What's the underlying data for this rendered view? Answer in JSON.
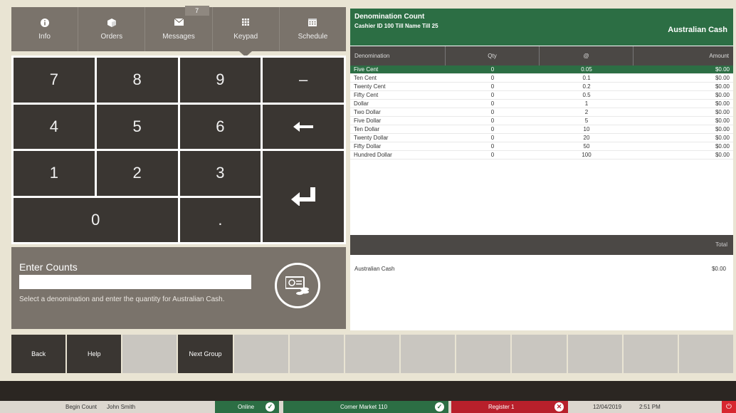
{
  "nav": {
    "items": [
      {
        "label": "Info",
        "icon": "info-icon"
      },
      {
        "label": "Orders",
        "icon": "box-icon"
      },
      {
        "label": "Messages",
        "icon": "envelope-icon",
        "badge": "7"
      },
      {
        "label": "Keypad",
        "icon": "keypad-icon"
      },
      {
        "label": "Schedule",
        "icon": "calendar-icon"
      }
    ]
  },
  "keypad": {
    "keys": [
      "7",
      "8",
      "9",
      "–",
      "4",
      "5",
      "6",
      "←",
      "1",
      "2",
      "3",
      "↵",
      "0",
      "."
    ]
  },
  "counts": {
    "title": "Enter Counts",
    "input_value": "",
    "help": "Select a denomination and enter the quantity for Australian Cash."
  },
  "panel": {
    "title": "Denomination Count",
    "subtitle": "Cashier ID 100 Till Name Till 25",
    "currency": "Australian Cash",
    "headers": [
      "Denomination",
      "Qty",
      "@",
      "Amount"
    ],
    "rows": [
      {
        "name": "Five Cent",
        "qty": "0",
        "at": "0.05",
        "amount": "$0.00"
      },
      {
        "name": "Ten Cent",
        "qty": "0",
        "at": "0.1",
        "amount": "$0.00"
      },
      {
        "name": "Twenty Cent",
        "qty": "0",
        "at": "0.2",
        "amount": "$0.00"
      },
      {
        "name": "Fifty Cent",
        "qty": "0",
        "at": "0.5",
        "amount": "$0.00"
      },
      {
        "name": "Dollar",
        "qty": "0",
        "at": "1",
        "amount": "$0.00"
      },
      {
        "name": "Two Dollar",
        "qty": "0",
        "at": "2",
        "amount": "$0.00"
      },
      {
        "name": "Five Dollar",
        "qty": "0",
        "at": "5",
        "amount": "$0.00"
      },
      {
        "name": "Ten Dollar",
        "qty": "0",
        "at": "10",
        "amount": "$0.00"
      },
      {
        "name": "Twenty Dollar",
        "qty": "0",
        "at": "20",
        "amount": "$0.00"
      },
      {
        "name": "Fifty Dollar",
        "qty": "0",
        "at": "50",
        "amount": "$0.00"
      },
      {
        "name": "Hundred Dollar",
        "qty": "0",
        "at": "100",
        "amount": "$0.00"
      }
    ],
    "total_label": "Total",
    "summary_label": "Australian Cash",
    "summary_amount": "$0.00"
  },
  "functions": [
    "Back",
    "Help",
    "",
    "Next Group",
    "",
    "",
    "",
    "",
    "",
    "",
    "",
    "",
    ""
  ],
  "status": {
    "mode": "Begin Count",
    "user": "John Smith",
    "online": "Online",
    "store": "Corner Market 110",
    "register": "Register 1",
    "date": "12/04/2019",
    "time": "2:51 PM"
  },
  "colors": {
    "accent_green": "#2c6e44",
    "alert_red": "#b8202b",
    "key_dark": "#3a3632",
    "panel_taupe": "#7a736b"
  }
}
